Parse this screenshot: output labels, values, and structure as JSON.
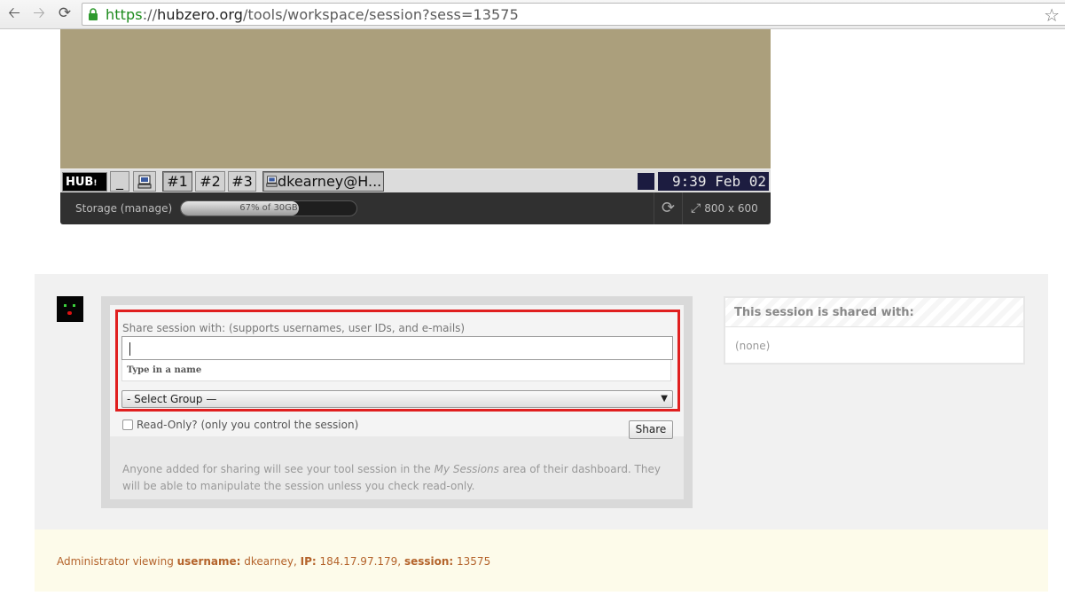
{
  "browser": {
    "url_scheme": "https",
    "url_host": "hubzero.org",
    "url_path": "/tools/workspace/session?sess=13575",
    "back_icon": "back-arrow-icon",
    "forward_icon": "forward-arrow-icon",
    "reload_icon": "reload-icon",
    "lock_icon": "lock-icon",
    "star_icon": "bookmark-star-icon"
  },
  "taskbar": {
    "logo": "HUB",
    "minimize": "_",
    "workspaces": [
      "#1",
      "#2",
      "#3"
    ],
    "window_title": "dkearney@H...",
    "clock": "9:39 Feb 02"
  },
  "storage": {
    "label": "Storage (manage)",
    "percent_used": 67,
    "meter_text": "67% of 30GB",
    "resolution": "800 x 600"
  },
  "share": {
    "label": "Share session with: (supports usernames, user IDs, and e-mails)",
    "input_value": "",
    "hint": "Type in a name",
    "group_select": "- Select Group —",
    "readonly_label": "Read-Only? (only you control the session)",
    "share_button": "Share",
    "note_before": "Anyone added for sharing will see your tool session in the ",
    "note_em": "My Sessions",
    "note_after": " area of their dashboard. They will be able to manipulate the session unless you check read-only."
  },
  "shared_with": {
    "title": "This session is shared with:",
    "value": "(none)"
  },
  "admin": {
    "prefix": "Administrator viewing ",
    "username_label": "username:",
    "username": "dkearney",
    "ip_label": "IP:",
    "ip": "184.17.97.179",
    "session_label": "session:",
    "session": "13575"
  }
}
